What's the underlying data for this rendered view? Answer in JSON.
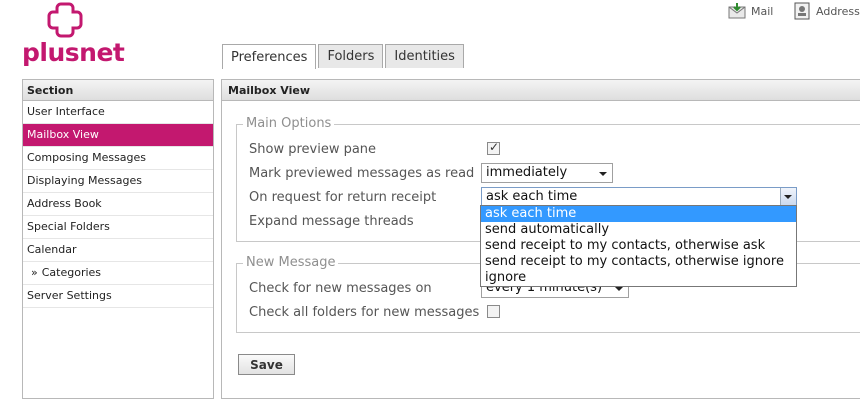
{
  "brand": {
    "name": "plusnet",
    "color": "#c3186f"
  },
  "toplinks": [
    {
      "label": "Mail",
      "icon": "mail-icon"
    },
    {
      "label": "Address Book",
      "icon": "address-book-icon"
    }
  ],
  "tabs": [
    {
      "label": "Preferences",
      "active": true
    },
    {
      "label": "Folders",
      "active": false
    },
    {
      "label": "Identities",
      "active": false
    }
  ],
  "sidebar": {
    "header": "Section",
    "items": [
      {
        "label": "User Interface"
      },
      {
        "label": "Mailbox View",
        "selected": true
      },
      {
        "label": "Composing Messages"
      },
      {
        "label": "Displaying Messages"
      },
      {
        "label": "Address Book"
      },
      {
        "label": "Special Folders"
      },
      {
        "label": "Calendar"
      },
      {
        "label": "Categories",
        "sub": true,
        "bullet": "»"
      },
      {
        "label": "Server Settings"
      }
    ]
  },
  "main": {
    "header": "Mailbox View",
    "main_options": {
      "legend": "Main Options",
      "show_preview_pane": {
        "label": "Show preview pane",
        "checked": true
      },
      "mark_previewed": {
        "label": "Mark previewed messages as read",
        "value": "immediately"
      },
      "return_receipt": {
        "label": "On request for return receipt",
        "value": "ask each time",
        "options": [
          "ask each time",
          "send automatically",
          "send receipt to my contacts, otherwise ask",
          "send receipt to my contacts, otherwise ignore",
          "ignore"
        ]
      },
      "expand_threads": {
        "label": "Expand message threads"
      }
    },
    "new_message": {
      "legend": "New Message",
      "check_new": {
        "label": "Check for new messages on",
        "value": "every 1 minute(s)"
      },
      "check_all_folders": {
        "label": "Check all folders for new messages",
        "checked": false
      }
    },
    "save_label": "Save"
  }
}
